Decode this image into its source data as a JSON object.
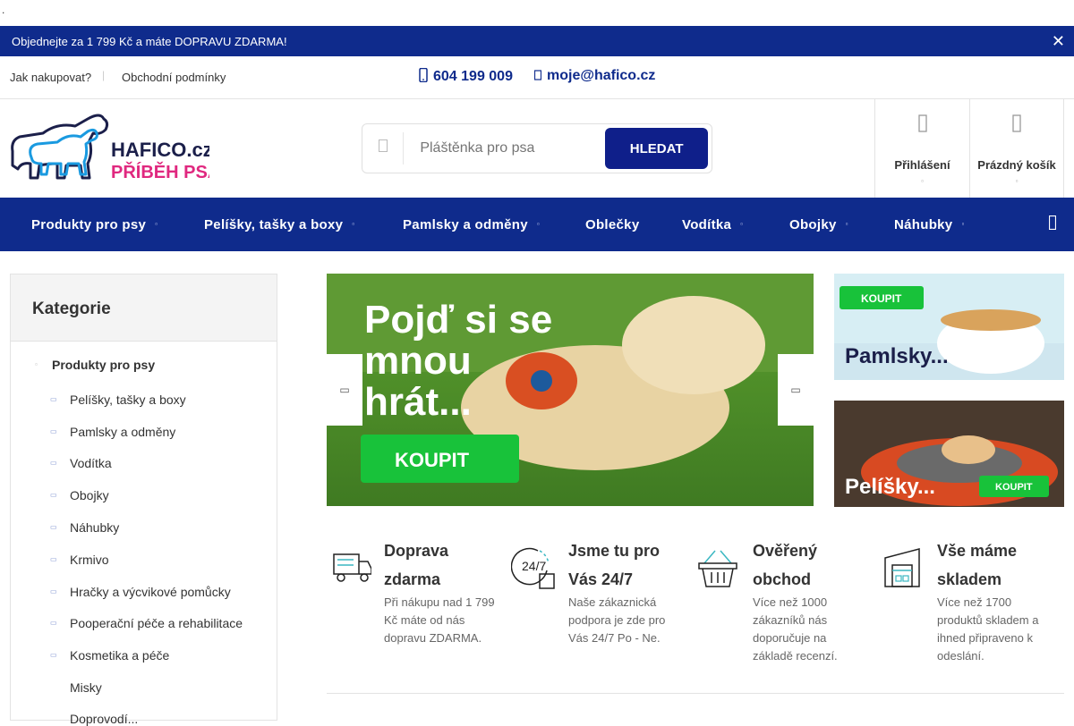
{
  "stray_dot": ".",
  "promo": {
    "text": "Objednejte za 1 799 Kč a máte DOPRAVU ZDARMA!",
    "close": "✕"
  },
  "topbar": {
    "links": [
      "Jak nakupovat?",
      "Obchodní podmínky"
    ],
    "phone": "604 199 009",
    "email": "moje@hafico.cz"
  },
  "logo": {
    "line1": "HAFICO.cz",
    "line2": "PŘÍBĚH PSA"
  },
  "search": {
    "placeholder": "Pláštěnka pro psa",
    "button": "HLEDAT"
  },
  "account": {
    "login": "Přihlášení",
    "cart": "Prázdný košík"
  },
  "nav": {
    "items": [
      "Produkty pro psy",
      "Pelíšky, tašky a boxy",
      "Pamlsky a odměny",
      "Oblečky",
      "Vodítka",
      "Obojky",
      "Náhubky"
    ]
  },
  "sidebar": {
    "title": "Kategorie",
    "root": "Produkty pro psy",
    "items": [
      "Pelíšky, tašky a boxy",
      "Pamlsky a odměny",
      "Vodítka",
      "Obojky",
      "Náhubky",
      "Krmivo",
      "Hračky a výcvikové pomůcky",
      "Pooperační péče a rehabilitace",
      "Kosmetika a péče",
      "Misky",
      "Doprovodí..."
    ]
  },
  "hero": {
    "line1": "Pojď si se",
    "line2": "mnou",
    "line3": "hrát...",
    "button": "KOUPIT"
  },
  "banners": [
    {
      "title": "Pamlsky...",
      "button": "KOUPIT"
    },
    {
      "title": "Pelíšky...",
      "button": "KOUPIT"
    }
  ],
  "features": [
    {
      "title": "Doprava zdarma",
      "desc": "Při nákupu nad 1 799 Kč máte od nás dopravu ZDARMA."
    },
    {
      "title": "Jsme tu pro Vás 24/7",
      "desc": "Naše zákaznická podpora je zde pro Vás 24/7 Po - Ne."
    },
    {
      "title": "Ověřený obchod",
      "desc": "Více než 1000 zákazníků nás doporučuje na základě recenzí."
    },
    {
      "title": "Vše máme skladem",
      "desc": "Více než 1700 produktů skladem a ihned připraveno k odeslání."
    }
  ],
  "colors": {
    "brand": "#0f2b8c",
    "button": "#0f1f8a",
    "koupit": "#18c23a",
    "logo_pink": "#e0287f",
    "logo_blue": "#1a9ae0"
  }
}
